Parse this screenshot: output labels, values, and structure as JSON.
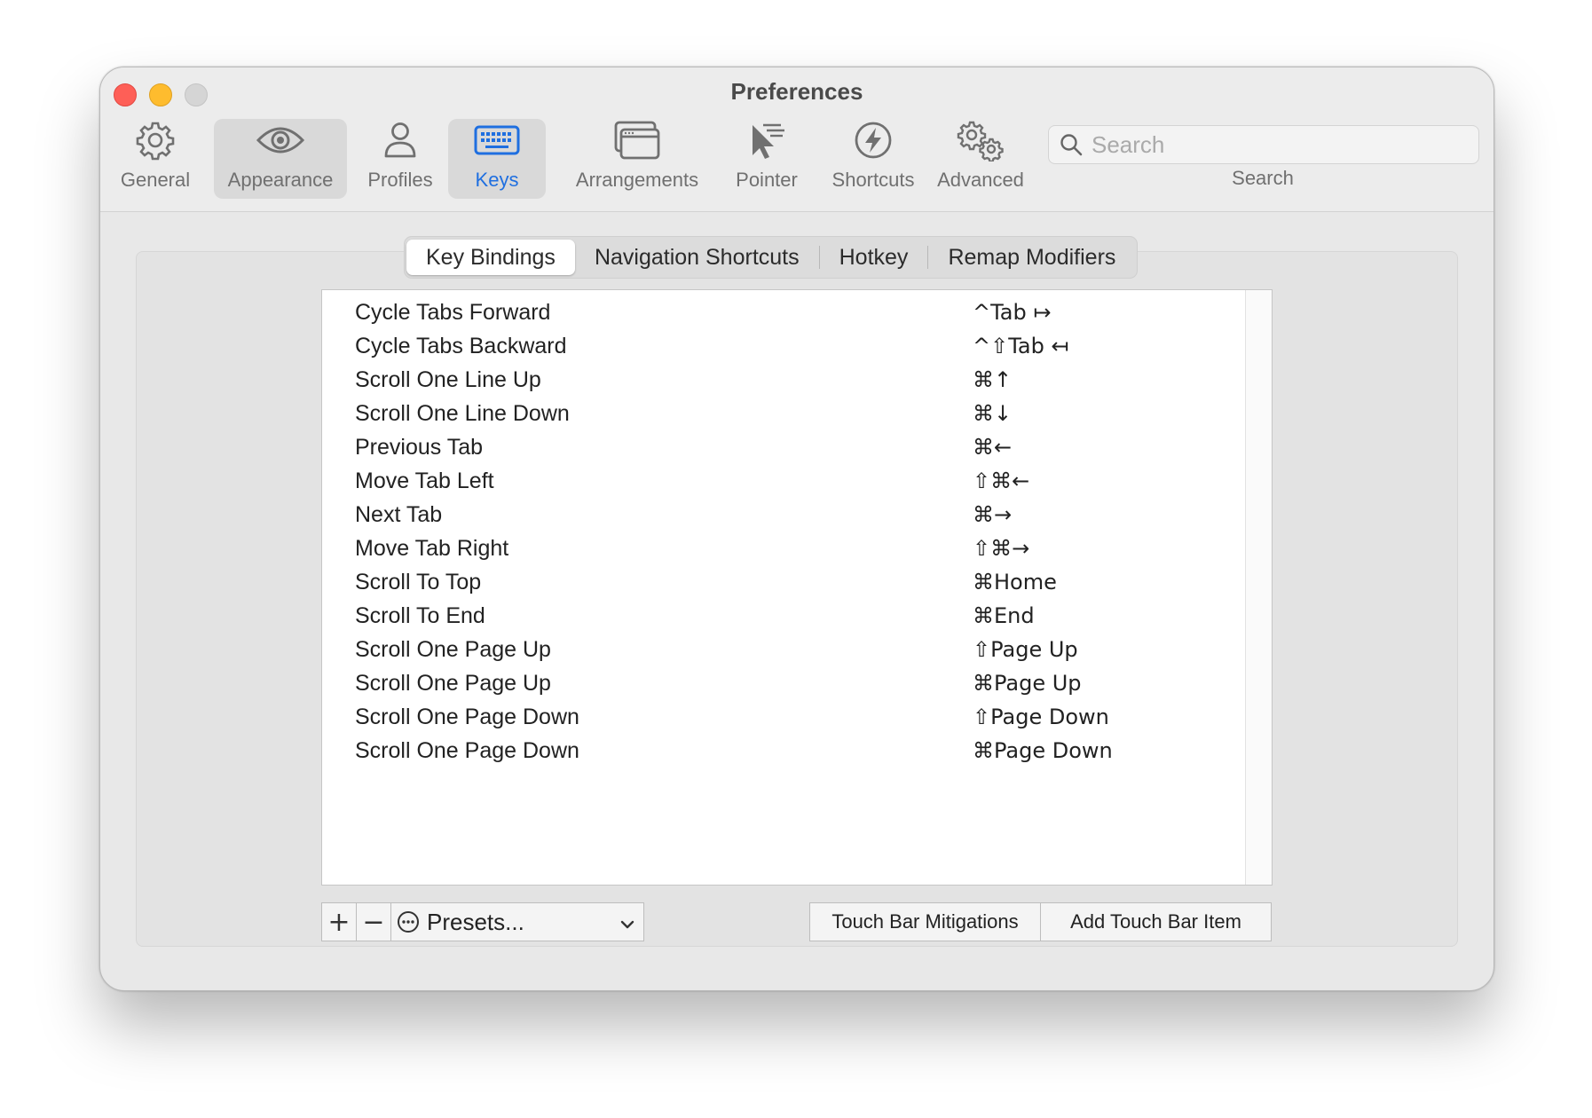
{
  "window": {
    "title": "Preferences"
  },
  "toolbar": {
    "items": [
      {
        "label": "General",
        "icon": "gear-icon"
      },
      {
        "label": "Appearance",
        "icon": "eye-icon"
      },
      {
        "label": "Profiles",
        "icon": "person-icon"
      },
      {
        "label": "Keys",
        "icon": "keyboard-icon"
      },
      {
        "label": "Arrangements",
        "icon": "windows-icon"
      },
      {
        "label": "Pointer",
        "icon": "pointer-icon"
      },
      {
        "label": "Shortcuts",
        "icon": "lightning-icon"
      },
      {
        "label": "Advanced",
        "icon": "gears-icon"
      }
    ],
    "active": "Keys",
    "search": {
      "placeholder": "Search",
      "caption": "Search"
    }
  },
  "tabs": [
    "Key Bindings",
    "Navigation Shortcuts",
    "Hotkey",
    "Remap Modifiers"
  ],
  "selected_tab": "Key Bindings",
  "bindings": [
    {
      "action": "Cycle Tabs Forward",
      "keys": "^Tab ↦"
    },
    {
      "action": "Cycle Tabs Backward",
      "keys": "^⇧Tab ↤"
    },
    {
      "action": "Scroll One Line Up",
      "keys": "⌘↑"
    },
    {
      "action": "Scroll One Line Down",
      "keys": "⌘↓"
    },
    {
      "action": "Previous Tab",
      "keys": "⌘←"
    },
    {
      "action": "Move Tab Left",
      "keys": "⇧⌘←"
    },
    {
      "action": "Next Tab",
      "keys": "⌘→"
    },
    {
      "action": "Move Tab Right",
      "keys": "⇧⌘→"
    },
    {
      "action": "Scroll To Top",
      "keys": "⌘Home"
    },
    {
      "action": "Scroll To End",
      "keys": "⌘End"
    },
    {
      "action": "Scroll One Page Up",
      "keys": "⇧Page Up"
    },
    {
      "action": "Scroll One Page Up",
      "keys": "⌘Page Up"
    },
    {
      "action": "Scroll One Page Down",
      "keys": "⇧Page Down"
    },
    {
      "action": "Scroll One Page Down",
      "keys": "⌘Page Down"
    }
  ],
  "bottom": {
    "add": "+",
    "remove": "−",
    "presets": "Presets...",
    "touch_bar_mitigations": "Touch Bar Mitigations",
    "add_touch_bar_item": "Add Touch Bar Item"
  },
  "colors": {
    "accent": "#1f6fe0",
    "close": "#fe5f57",
    "minimize": "#febc2e",
    "zoom": "#d5d5d5"
  }
}
